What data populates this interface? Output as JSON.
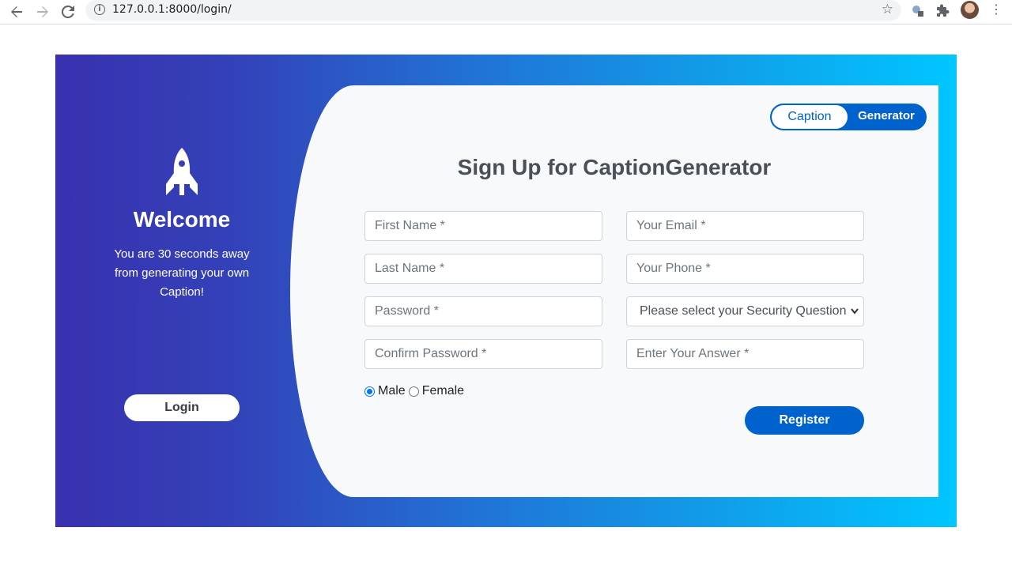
{
  "browser": {
    "url": "127.0.0.1:8000/login/",
    "back_icon": "arrow-left-icon",
    "forward_icon": "arrow-right-icon",
    "reload_icon": "reload-icon"
  },
  "left": {
    "icon": "rocket-icon",
    "welcome": "Welcome",
    "tagline": "You are 30 seconds away from generating your own Caption!",
    "login_label": "Login"
  },
  "toggle": {
    "left_label": "Caption",
    "right_label": "Generator"
  },
  "form": {
    "title": "Sign Up for CaptionGenerator",
    "first_name_placeholder": "First Name *",
    "last_name_placeholder": "Last Name *",
    "password_placeholder": "Password *",
    "confirm_password_placeholder": "Confirm Password *",
    "email_placeholder": "Your Email *",
    "phone_placeholder": "Your Phone *",
    "security_question": "Please select your Security Question",
    "answer_placeholder": "Enter Your Answer *",
    "gender_options": [
      "Male",
      "Female"
    ],
    "gender_selected": "Male",
    "register_label": "Register"
  },
  "colors": {
    "primary": "#0062cc",
    "gradient_start": "#3931af",
    "gradient_end": "#00c6ff"
  }
}
